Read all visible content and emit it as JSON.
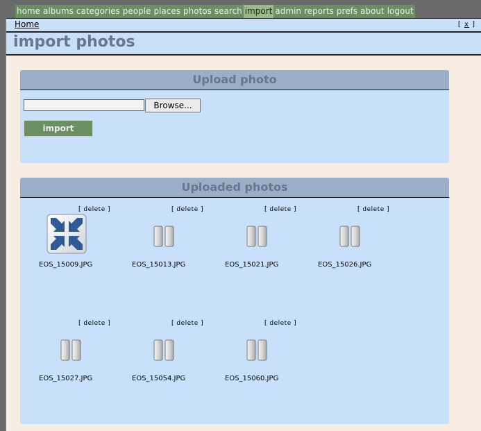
{
  "nav": {
    "items": [
      {
        "label": "home",
        "active": false
      },
      {
        "label": "albums",
        "active": false
      },
      {
        "label": "categories",
        "active": false
      },
      {
        "label": "people",
        "active": false
      },
      {
        "label": "places",
        "active": false
      },
      {
        "label": "photos",
        "active": false
      },
      {
        "label": "search",
        "active": false
      },
      {
        "label": "import",
        "active": true
      },
      {
        "label": "admin",
        "active": false
      },
      {
        "label": "reports",
        "active": false
      },
      {
        "label": "prefs",
        "active": false
      },
      {
        "label": "about",
        "active": false
      },
      {
        "label": "logout",
        "active": false
      }
    ]
  },
  "breadcrumb": {
    "home": "Home",
    "close_pre": "[ ",
    "close_x": "x",
    "close_post": " ]"
  },
  "page": {
    "title": "import photos"
  },
  "upload": {
    "header": "Upload photo",
    "file_value": "",
    "browse_label": "Browse...",
    "import_label": "import"
  },
  "uploaded": {
    "header": "Uploaded photos",
    "delete_label": "[ delete ]",
    "photos": [
      {
        "filename": "EOS_15009.JPG",
        "icon": "loading-arrows-icon"
      },
      {
        "filename": "EOS_15013.JPG",
        "icon": "pause-icon"
      },
      {
        "filename": "EOS_15021.JPG",
        "icon": "pause-icon"
      },
      {
        "filename": "EOS_15026.JPG",
        "icon": "pause-icon"
      },
      {
        "filename": "EOS_15027.JPG",
        "icon": "pause-icon"
      },
      {
        "filename": "EOS_15054.JPG",
        "icon": "pause-icon"
      },
      {
        "filename": "EOS_15060.JPG",
        "icon": "pause-icon"
      }
    ]
  },
  "colors": {
    "nav_bg": "#6b8f62",
    "nav_active": "#9ab889",
    "panel_bg": "#c9e0fb",
    "panel_header": "#9aaec8",
    "frame_bg": "#f7ede2",
    "title_text": "#67788c"
  }
}
